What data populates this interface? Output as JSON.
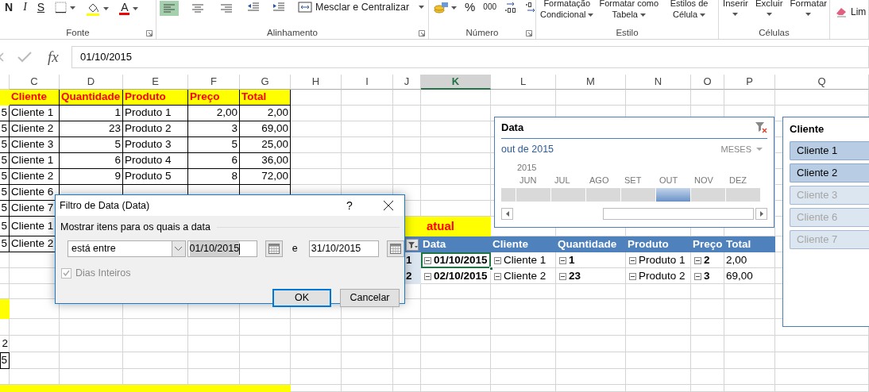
{
  "ribbon": {
    "groups": [
      {
        "label": "Fonte",
        "launcher": true,
        "items": [
          {
            "kind": "bold",
            "text": "N"
          },
          {
            "kind": "italic",
            "text": "I"
          },
          {
            "kind": "underline",
            "text": "S"
          },
          {
            "kind": "borders"
          },
          {
            "kind": "fill"
          },
          {
            "kind": "fontcolor",
            "text": "A"
          }
        ]
      },
      {
        "label": "Alinhamento",
        "launcher": true,
        "items": [
          {
            "kind": "alignleft",
            "selected": true
          },
          {
            "kind": "aligncenter",
            "selected": false
          },
          {
            "kind": "alignright",
            "selected": false
          },
          {
            "kind": "outdent"
          },
          {
            "kind": "indent"
          },
          {
            "kind": "merge",
            "text": "Mesclar e Centralizar"
          }
        ]
      },
      {
        "label": "Número",
        "launcher": true,
        "items": [
          {
            "kind": "currency"
          },
          {
            "kind": "textbutton",
            "text": "%"
          },
          {
            "kind": "textbutton",
            "text": "000"
          },
          {
            "kind": "decinc"
          },
          {
            "kind": "decdec"
          }
        ]
      },
      {
        "label": "Estilo",
        "launcher": false,
        "items": [
          {
            "kind": "menu",
            "lines": [
              "Formatação",
              "Condicional"
            ]
          },
          {
            "kind": "menu",
            "lines": [
              "Formatar como",
              "Tabela"
            ]
          },
          {
            "kind": "menu",
            "lines": [
              "Estilos de",
              "Célula"
            ]
          }
        ]
      },
      {
        "label": "Células",
        "launcher": false,
        "items": [
          {
            "kind": "cellmenu",
            "text": "Inserir"
          },
          {
            "kind": "cellmenu",
            "text": "Excluir"
          },
          {
            "kind": "cellmenu",
            "text": "Formatar"
          }
        ]
      },
      {
        "launcher": false,
        "items": [
          {
            "kind": "eraser",
            "text": "Lim"
          }
        ]
      }
    ]
  },
  "formula_bar": {
    "fx": "fx",
    "value": "01/10/2015"
  },
  "sheet": {
    "columns": [
      {
        "label": "C",
        "selected": false
      },
      {
        "label": "D",
        "selected": false
      },
      {
        "label": "E",
        "selected": false
      },
      {
        "label": "F",
        "selected": false
      },
      {
        "label": "G",
        "selected": false
      },
      {
        "label": "H",
        "selected": false
      },
      {
        "label": "I",
        "selected": false
      },
      {
        "label": "J",
        "selected": false
      },
      {
        "label": "K",
        "selected": true
      },
      {
        "label": "L",
        "selected": false
      },
      {
        "label": "M",
        "selected": false
      },
      {
        "label": "N",
        "selected": false
      },
      {
        "label": "O",
        "selected": false
      },
      {
        "label": "P",
        "selected": false
      },
      {
        "label": "Q",
        "selected": false
      }
    ],
    "rows": [
      {
        "edge": {
          "kind": "highlight",
          "selected": false
        },
        "cells": [
          {
            "kind": "header",
            "text": "Cliente",
            "selected": false
          },
          {
            "kind": "header",
            "text": "Quantidade",
            "selected": false
          },
          {
            "kind": "header",
            "text": "Produto",
            "selected": false
          },
          {
            "kind": "header",
            "text": "Preço",
            "selected": false
          },
          {
            "kind": "header",
            "text": "Total",
            "selected": false
          }
        ]
      },
      {
        "edge": {
          "kind": "number",
          "text": "5",
          "selected": false
        },
        "cells": [
          {
            "kind": "text",
            "text": "Cliente 1",
            "selected": false
          },
          {
            "kind": "number",
            "text": "1",
            "selected": false
          },
          {
            "kind": "text",
            "text": "Produto 1",
            "selected": false
          },
          {
            "kind": "number",
            "text": "2,00",
            "selected": false
          },
          {
            "kind": "number",
            "text": "2,00",
            "selected": false
          }
        ]
      },
      {
        "edge": {
          "kind": "number",
          "text": "5",
          "selected": false
        },
        "cells": [
          {
            "kind": "text",
            "text": "Cliente 2",
            "selected": false
          },
          {
            "kind": "number",
            "text": "23",
            "selected": false
          },
          {
            "kind": "text",
            "text": "Produto 2",
            "selected": false
          },
          {
            "kind": "number",
            "text": "3",
            "selected": false
          },
          {
            "kind": "number",
            "text": "69,00",
            "selected": false
          }
        ]
      },
      {
        "edge": {
          "kind": "number",
          "text": "5",
          "selected": false
        },
        "cells": [
          {
            "kind": "text",
            "text": "Cliente 3",
            "selected": false
          },
          {
            "kind": "number",
            "text": "5",
            "selected": false
          },
          {
            "kind": "text",
            "text": "Produto 3",
            "selected": false
          },
          {
            "kind": "number",
            "text": "5",
            "selected": false
          },
          {
            "kind": "number",
            "text": "25,00",
            "selected": false
          }
        ]
      },
      {
        "edge": {
          "kind": "number",
          "text": "5",
          "selected": false
        },
        "cells": [
          {
            "kind": "text",
            "text": "Cliente 1",
            "selected": false
          },
          {
            "kind": "number",
            "text": "6",
            "selected": false
          },
          {
            "kind": "text",
            "text": "Produto 4",
            "selected": false
          },
          {
            "kind": "number",
            "text": "6",
            "selected": false
          },
          {
            "kind": "number",
            "text": "36,00",
            "selected": false
          }
        ]
      },
      {
        "edge": {
          "kind": "number",
          "text": "5",
          "selected": false
        },
        "cells": [
          {
            "kind": "text",
            "text": "Cliente 2",
            "selected": false
          },
          {
            "kind": "number",
            "text": "9",
            "selected": false
          },
          {
            "kind": "text",
            "text": "Produto 5",
            "selected": false
          },
          {
            "kind": "number",
            "text": "8",
            "selected": false
          },
          {
            "kind": "number",
            "text": "72,00",
            "selected": false
          }
        ]
      },
      {
        "edge": {
          "kind": "number",
          "text": "5",
          "selected": false
        },
        "cells": [
          {
            "kind": "text",
            "text": "Cliente 6",
            "selected": false
          },
          {
            "kind": "number",
            "selected": false
          },
          {
            "kind": "text",
            "selected": false
          },
          {
            "kind": "number",
            "selected": false
          },
          {
            "kind": "number",
            "selected": false
          }
        ]
      },
      {
        "edge": {
          "kind": "number",
          "text": "5",
          "selected": false
        },
        "cells": [
          {
            "kind": "text",
            "text": "Cliente 7",
            "selected": false
          }
        ]
      },
      {
        "edge": {
          "kind": "number",
          "text": "5",
          "selected": false
        },
        "cells": [
          {
            "kind": "text",
            "text": "Cliente 1",
            "selected": false
          },
          {
            "kind": "empty"
          },
          {
            "kind": "empty"
          },
          {
            "kind": "empty"
          },
          {
            "kind": "empty"
          },
          {
            "kind": "empty"
          },
          {
            "kind": "empty"
          },
          {
            "kind": "highlight",
            "selected": false
          },
          {
            "kind": "title",
            "text": "atual",
            "selected": false
          }
        ]
      },
      {
        "edge": {
          "kind": "number",
          "text": "5",
          "selected": false
        },
        "cells": [
          {
            "kind": "text",
            "text": "Cliente 2",
            "selected": false
          },
          {
            "kind": "empty"
          },
          {
            "kind": "empty"
          },
          {
            "kind": "empty"
          },
          {
            "kind": "empty"
          },
          {
            "kind": "empty"
          },
          {
            "kind": "empty"
          },
          {
            "kind": "pivot-filter",
            "selected": false
          },
          {
            "kind": "pivot-header",
            "text": "Data",
            "selected": false
          },
          {
            "kind": "pivot-header",
            "text": "Cliente",
            "selected": false
          },
          {
            "kind": "pivot-header",
            "text": "Quantidade",
            "selected": false
          },
          {
            "kind": "pivot-header",
            "text": "Produto",
            "selected": false
          },
          {
            "kind": "pivot-header",
            "text": "Preço",
            "selected": false
          },
          {
            "kind": "pivot-header",
            "text": "Total",
            "selected": false
          }
        ]
      },
      {
        "cells": [
          {
            "kind": "empty"
          },
          {
            "kind": "empty"
          },
          {
            "kind": "empty"
          },
          {
            "kind": "empty"
          },
          {
            "kind": "empty"
          },
          {
            "kind": "empty"
          },
          {
            "kind": "empty"
          },
          {
            "kind": "pivot-index",
            "text": "1",
            "selected": false
          },
          {
            "kind": "pivot-item",
            "text": "01/10/2015",
            "bold": true,
            "expanded": true,
            "selected": true
          },
          {
            "kind": "pivot-item",
            "text": "Cliente 1",
            "bold": false,
            "expanded": true,
            "selected": false
          },
          {
            "kind": "pivot-item",
            "text": "1",
            "bold": true,
            "expanded": true,
            "selected": false
          },
          {
            "kind": "pivot-item",
            "text": "Produto 1",
            "bold": false,
            "expanded": true,
            "selected": false
          },
          {
            "kind": "pivot-item",
            "text": "2",
            "bold": true,
            "expanded": true,
            "selected": false
          },
          {
            "kind": "pivot-value",
            "text": "2,00",
            "selected": false
          }
        ]
      },
      {
        "cells": [
          {
            "kind": "empty"
          },
          {
            "kind": "empty"
          },
          {
            "kind": "empty"
          },
          {
            "kind": "empty"
          },
          {
            "kind": "empty"
          },
          {
            "kind": "empty"
          },
          {
            "kind": "empty"
          },
          {
            "kind": "pivot-index",
            "text": "2",
            "selected": false
          },
          {
            "kind": "pivot-item",
            "text": "02/10/2015",
            "bold": true,
            "expanded": true,
            "selected": false
          },
          {
            "kind": "pivot-item",
            "text": "Cliente 2",
            "bold": false,
            "expanded": true,
            "selected": false
          },
          {
            "kind": "pivot-item",
            "text": "23",
            "bold": true,
            "expanded": true,
            "selected": false
          },
          {
            "kind": "pivot-item",
            "text": "Produto 2",
            "bold": false,
            "expanded": true,
            "selected": false
          },
          {
            "kind": "pivot-item",
            "text": "3",
            "bold": true,
            "expanded": true,
            "selected": false
          },
          {
            "kind": "pivot-value",
            "text": "69,00",
            "selected": false
          }
        ]
      },
      {
        "cells": []
      },
      {
        "edge": {
          "kind": "highlight",
          "selected": false
        },
        "cells": []
      },
      {
        "cells": []
      },
      {
        "edge": {
          "kind": "plain-number",
          "text": "2",
          "selected": false
        },
        "cells": []
      },
      {
        "edge": {
          "kind": "boxed-number",
          "text": "5",
          "selected": false
        },
        "cells": []
      },
      {
        "cells": []
      },
      {
        "edge": {
          "kind": "highlight",
          "selected": false
        },
        "cells": [
          {
            "kind": "highlight",
            "selected": false
          },
          {
            "kind": "highlight",
            "selected": false
          },
          {
            "kind": "highlight",
            "selected": false
          },
          {
            "kind": "highlight",
            "selected": false
          },
          {
            "kind": "highlight",
            "selected": false
          }
        ]
      }
    ]
  },
  "timeline": {
    "title": "Data",
    "range_label": "out de 2015",
    "level_label": "MESES",
    "year": "2015",
    "months": [
      {
        "label": "JUN",
        "selected": false
      },
      {
        "label": "JUL",
        "selected": false
      },
      {
        "label": "AGO",
        "selected": false
      },
      {
        "label": "SET",
        "selected": false
      },
      {
        "label": "OUT",
        "selected": true
      },
      {
        "label": "NOV",
        "selected": false
      },
      {
        "label": "DEZ",
        "selected": false
      }
    ]
  },
  "client_slicer": {
    "title": "Cliente",
    "items": [
      {
        "label": "Cliente 1",
        "selected": true
      },
      {
        "label": "Cliente 2",
        "selected": true
      },
      {
        "label": "Cliente 3",
        "selected": false
      },
      {
        "label": "Cliente 6",
        "selected": false
      },
      {
        "label": "Cliente 7",
        "selected": false
      }
    ]
  },
  "dialog": {
    "title": "Filtro de Data (Data)",
    "help": "?",
    "group_label": "Mostrar itens para os quais a data",
    "condition": "está entre",
    "start": {
      "value": "01/10/2015",
      "text_selected": true
    },
    "joiner": "e",
    "end": {
      "value": "31/10/2015",
      "text_selected": false
    },
    "checkbox": {
      "label": "Dias Inteiros",
      "checked": true,
      "disabled": true
    },
    "buttons": [
      {
        "label": "OK",
        "default": true
      },
      {
        "label": "Cancelar",
        "default": false
      }
    ]
  }
}
